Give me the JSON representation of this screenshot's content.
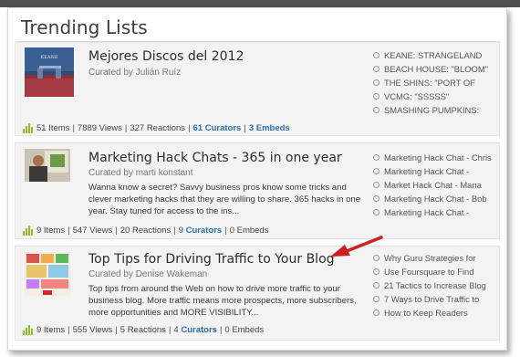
{
  "section": {
    "title": "Trending Lists"
  },
  "colors": {
    "accent_link": "#2a6fb0",
    "bars_icon": "#8cbf2a",
    "arrow": "#cc2020"
  },
  "cards": [
    {
      "title": "Mejores Discos del 2012",
      "curated": "Curated by Julián Ruíz",
      "thumb_text": "KEANE",
      "stats": {
        "items": "51 Items",
        "views": "7889 Views",
        "reactions": "327 Reactions",
        "curators_count": "61",
        "curators_label": "Curators",
        "embeds_count": "3",
        "embeds_label": "Embeds"
      },
      "side_items": [
        "KEANE: STRANGELAND",
        "BEACH HOUSE: \"BLOOM\"",
        "THE SHINS: \"PORT OF",
        "VCMG: \"SSSSS\"",
        "SMASHING PUMPKINS:"
      ]
    },
    {
      "title": "Marketing Hack Chats - 365 in one year",
      "curated": "Curated by marti konstant",
      "description": "Wanna know a secret? Savvy business pros know some tricks and clever marketing hacks that they are willing to share. 365 hacks in one year. Stay tuned for access to the ins...",
      "stats": {
        "items": "9 Items",
        "views": "547 Views",
        "reactions": "20 Reactions",
        "curators_count": "9",
        "curators_label": "Curators",
        "embeds_text": "0 Embeds"
      },
      "side_items": [
        "Marketing Hack Chat - Chris",
        "Marketing Hack Chat -",
        "Market Hack Chat - Mana",
        "Marketing Hack Chat - Bob",
        "Marketing Hack Chat -"
      ]
    },
    {
      "title": "Top Tips for Driving Traffic to Your Blog",
      "curated": "Curated by Denise Wakeman",
      "description": "Top tips from around the Web on how to drive more traffic to your business blog. More traffic means more prospects, more subscribers, more opportunities and MORE VISIBILITY...",
      "stats": {
        "items": "9 Items",
        "views": "555 Views",
        "reactions": "5 Reactions",
        "curators_count": "4",
        "curators_label": "Curators",
        "embeds_text": "0 Embeds"
      },
      "side_items": [
        "Why Guru Strategies for",
        "Use Foursquare to Find",
        "21 Tactics to Increase Blog",
        "7 Ways to Drive Traffic to",
        "How to Keep Readers"
      ]
    }
  ]
}
